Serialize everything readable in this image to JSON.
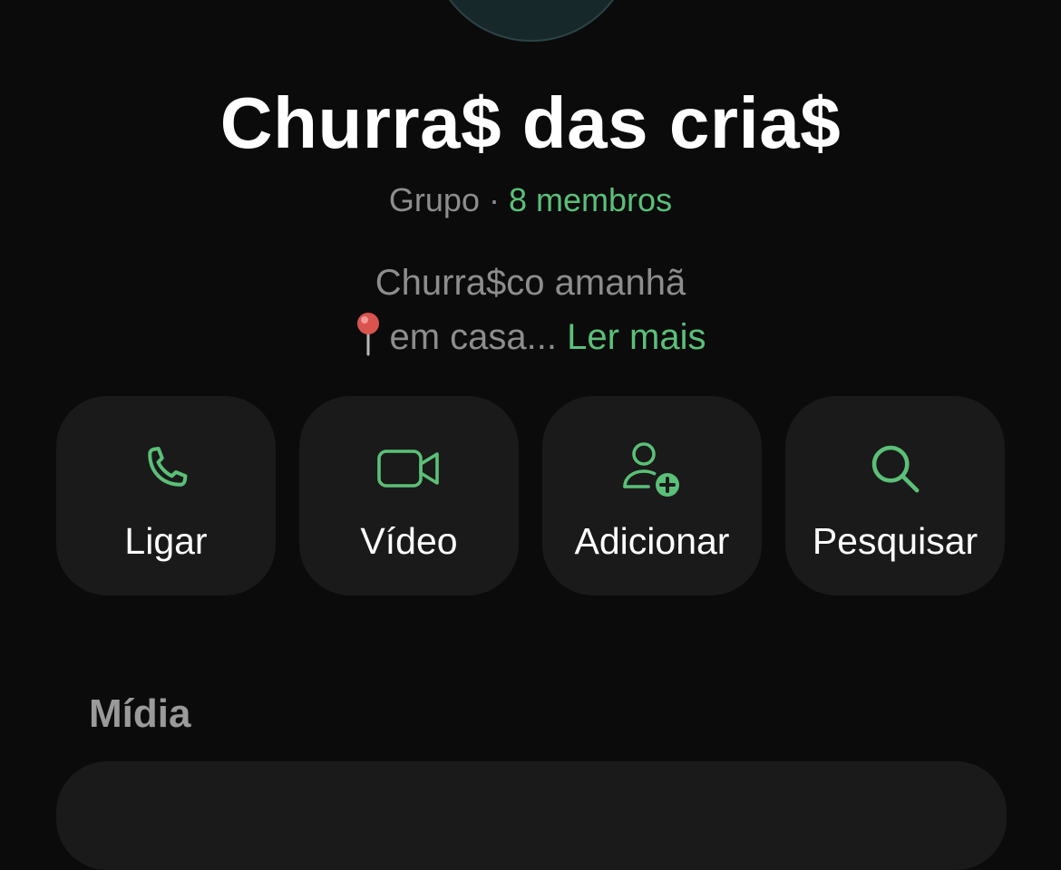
{
  "group": {
    "name": "Churra$ das cria$",
    "type_label": "Grupo",
    "separator": "·",
    "members_label": "8 membros",
    "description_line1": "Churra$co amanhã",
    "description_line2": "em casa...",
    "read_more": "Ler mais"
  },
  "actions": [
    {
      "label": "Ligar",
      "icon": "phone-icon"
    },
    {
      "label": "Vídeo",
      "icon": "video-camera-icon"
    },
    {
      "label": "Adicionar",
      "icon": "add-person-icon"
    },
    {
      "label": "Pesquisar",
      "icon": "search-icon"
    }
  ],
  "sections": {
    "media_title": "Mídia"
  },
  "colors": {
    "background": "#0b0b0b",
    "card": "#1a1a1a",
    "accent": "#5bc078",
    "muted": "#8d8d8d"
  }
}
